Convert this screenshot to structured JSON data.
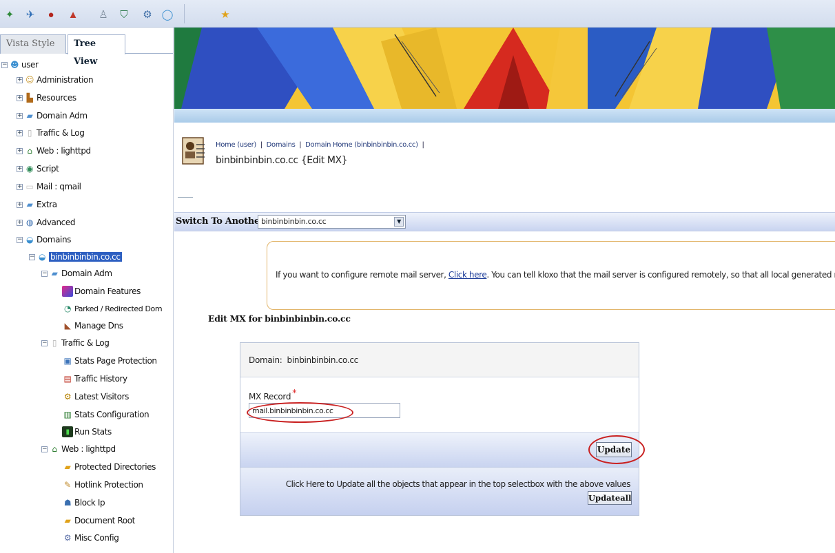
{
  "colors": {
    "selected": "#2d5fc1",
    "annotation": "#c92121",
    "link": "#1d3d99",
    "notice_border": "#e2b56a"
  },
  "toolbar": {
    "icons": [
      "home-icon",
      "tools-icon",
      "user-icon",
      "upload-icon",
      "person-icon",
      "shield-icon",
      "gear-icon",
      "globe-icon",
      "star-icon"
    ]
  },
  "sidebar": {
    "tabs": {
      "vista": "Vista Style",
      "tree": "Tree View"
    },
    "tree": {
      "root": "user",
      "top": [
        "Administration",
        "Resources",
        "Domain Adm",
        "Traffic & Log",
        "Web : lighttpd",
        "Script",
        "Mail : qmail",
        "Extra",
        "Advanced",
        "Domains"
      ],
      "domain": "binbinbinbin.co.cc",
      "domain_adm": {
        "label": "Domain Adm",
        "children": [
          "Domain Features",
          "Parked / Redirected Dom",
          "Manage Dns"
        ]
      },
      "traffic": {
        "label": "Traffic & Log",
        "children": [
          "Stats Page Protection",
          "Traffic History",
          "Latest Visitors",
          "Stats Configuration",
          "Run Stats"
        ]
      },
      "web": {
        "label": "Web : lighttpd",
        "children": [
          "Protected Directories",
          "Hotlink Protection",
          "Block Ip",
          "Document Root",
          "Misc Config"
        ]
      }
    }
  },
  "breadcrumb": {
    "home": "Home (user)",
    "domains": "Domains",
    "domain_home": "Domain Home (binbinbinbin.co.cc)",
    "title": "binbinbinbin.co.cc {Edit MX}"
  },
  "switch": {
    "label": "Switch To Another",
    "selected": "binbinbinbin.co.cc"
  },
  "notice": {
    "before": "If you want to configure remote mail server, ",
    "link": "Click here",
    "after": ". You can tell kloxo that the mail server is configured remotely, so that all local generated m"
  },
  "form": {
    "heading": "Edit MX for binbinbinbin.co.cc",
    "domain_label": "Domain:",
    "domain_value": "binbinbinbin.co.cc",
    "mx_label": "MX Record",
    "mx_required": "*",
    "mx_value": "mail.binbinbinbin.co.cc",
    "update": "Update",
    "updateall_text": "Click Here to Update all the objects that appear in the top selectbox with the above values",
    "updateall": "Updateall"
  }
}
